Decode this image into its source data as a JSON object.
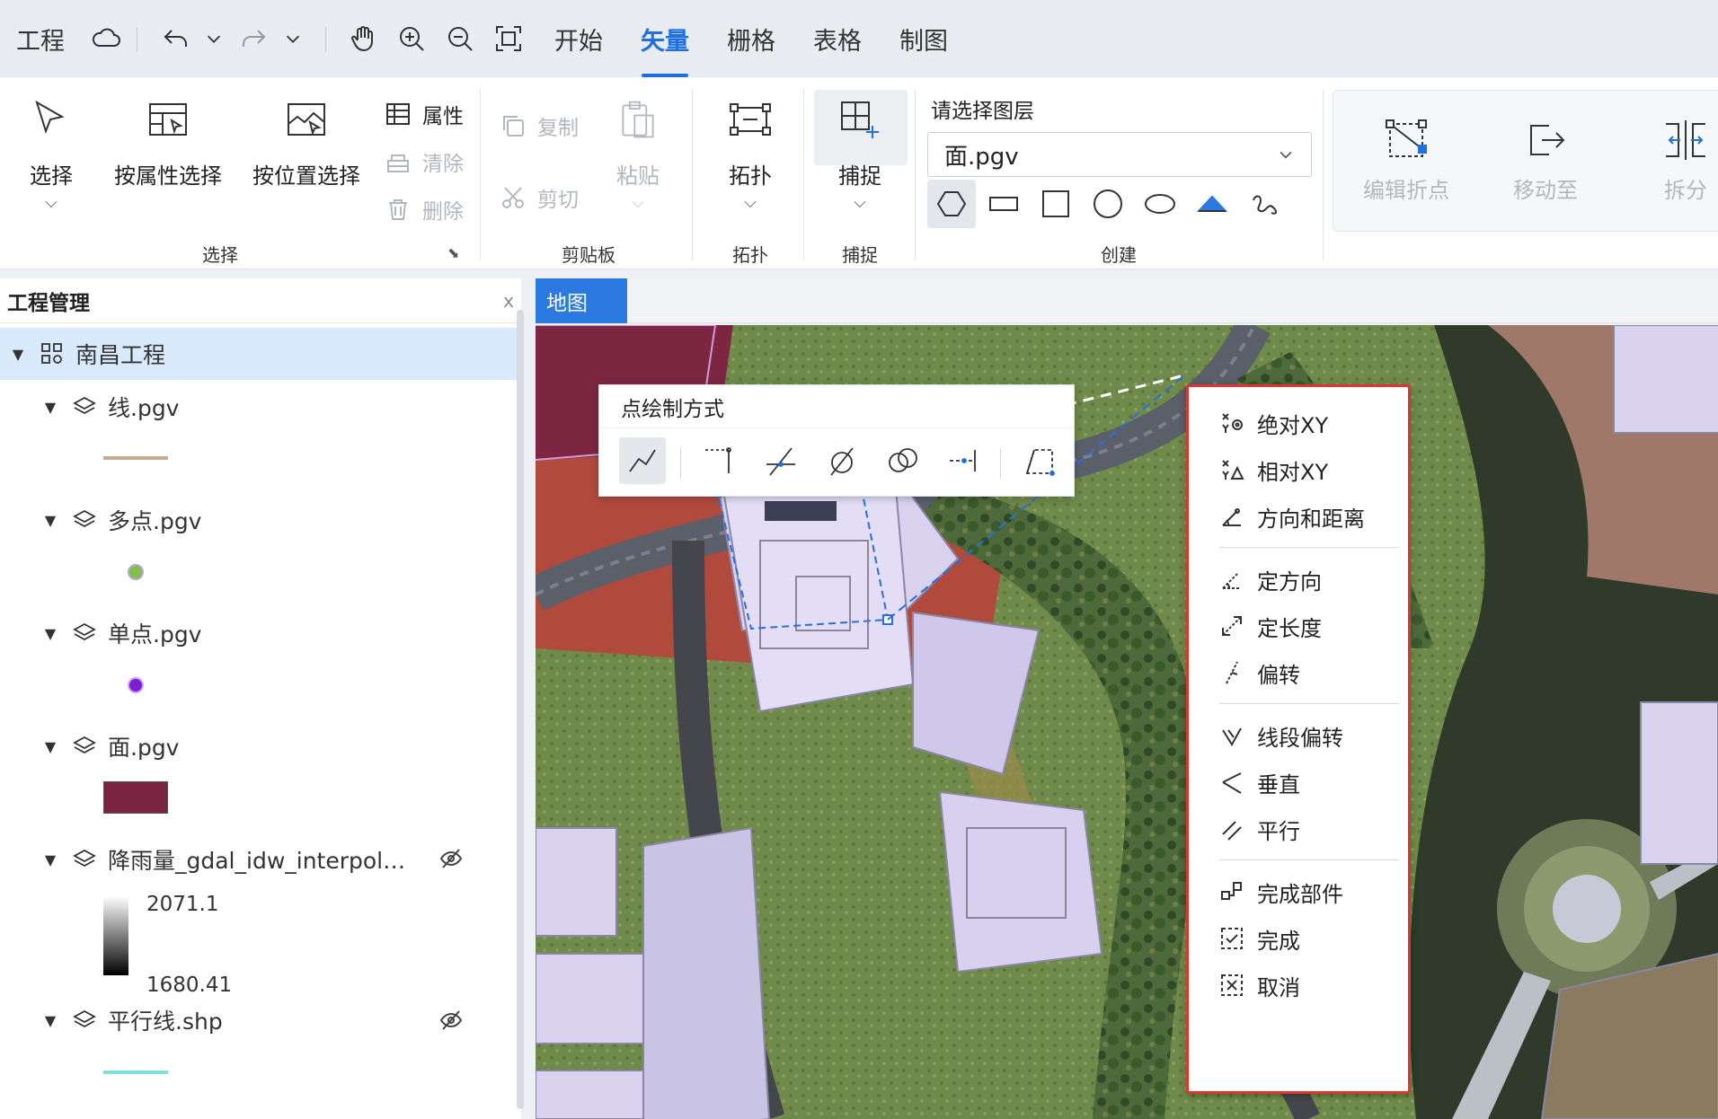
{
  "menubar": {
    "project_label": "工程",
    "tabs": [
      "开始",
      "矢量",
      "栅格",
      "表格",
      "制图"
    ],
    "active_tab": "矢量"
  },
  "ribbon": {
    "select_group": {
      "label": "选择",
      "select": "选择",
      "by_attribute": "按属性选择",
      "by_location": "按位置选择",
      "attributes": "属性",
      "clear": "清除",
      "delete": "删除"
    },
    "clipboard_group": {
      "label": "剪贴板",
      "copy": "复制",
      "cut": "剪切",
      "paste": "粘贴"
    },
    "topology_group": {
      "label": "拓扑",
      "topology": "拓扑"
    },
    "snap_group": {
      "label": "捕捉",
      "snap": "捕捉"
    },
    "create_group": {
      "label": "创建",
      "layer_prompt": "请选择图层",
      "layer_value": "面.pgv"
    },
    "edit_group": {
      "edit_vertices": "编辑折点",
      "move_to": "移动至",
      "split": "拆分"
    }
  },
  "project_panel": {
    "title": "工程管理",
    "close": "x",
    "project_name": "南昌工程",
    "layers": [
      {
        "name": "线.pgv",
        "legend_color": "#c4ad8e"
      },
      {
        "name": "多点.pgv",
        "legend_color": "#7fbf4a"
      },
      {
        "name": "单点.pgv",
        "legend_color": "#7a1fd6"
      },
      {
        "name": "面.pgv",
        "legend_color": "#7a2340"
      },
      {
        "name": "降雨量_gdal_idw_interpol…",
        "max": "2071.1",
        "min": "1680.41"
      },
      {
        "name": "平行线.shp",
        "legend_color": "#7fe0d6"
      }
    ]
  },
  "map": {
    "tab": "地图",
    "point_panel": {
      "title": "点绘制方式"
    },
    "context_menu": {
      "items": [
        "绝对XY",
        "相对XY",
        "方向和距离",
        "定方向",
        "定长度",
        "偏转",
        "线段偏转",
        "垂直",
        "平行",
        "完成部件",
        "完成",
        "取消"
      ]
    }
  },
  "colors": {
    "accent": "#1f6fe0",
    "menu_border": "#e0342f",
    "selected_row": "#d9eafd"
  }
}
